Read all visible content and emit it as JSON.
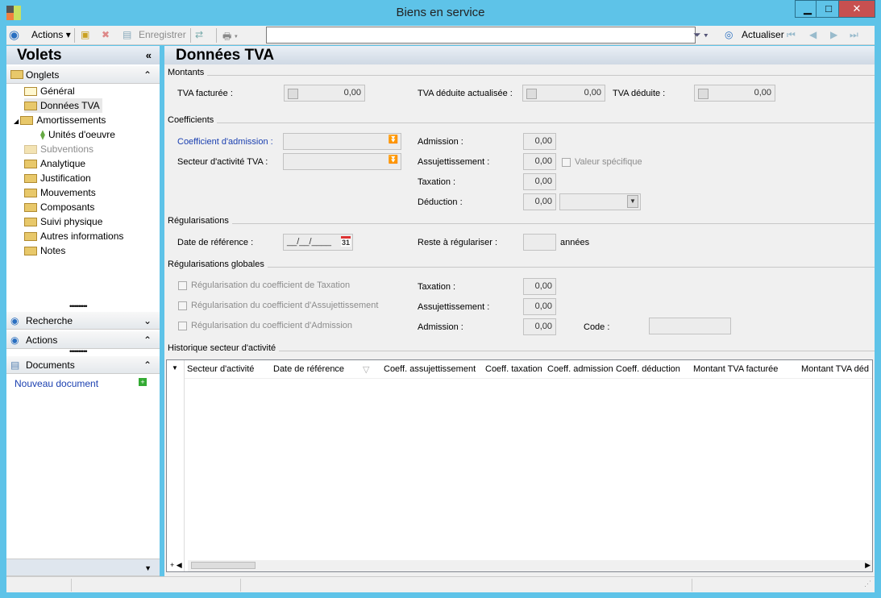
{
  "window": {
    "title": "Biens en service"
  },
  "toolbar": {
    "actions": "Actions",
    "save": "Enregistrer",
    "search_value": "",
    "refresh": "Actualiser"
  },
  "left": {
    "title": "Volets",
    "onglets": "Onglets",
    "tree": [
      "Général",
      "Données TVA",
      "Amortissements",
      "Unités d'oeuvre",
      "Subventions",
      "Analytique",
      "Justification",
      "Mouvements",
      "Composants",
      "Suivi physique",
      "Autres informations",
      "Notes"
    ],
    "recherche": "Recherche",
    "actions": "Actions",
    "documents": "Documents",
    "new_document": "Nouveau document"
  },
  "main": {
    "title": "Données TVA",
    "montants": {
      "label": "Montants",
      "tva_facturee": "TVA facturée :",
      "tva_facturee_val": "0,00",
      "tva_deduite_act": "TVA déduite actualisée :",
      "tva_deduite_act_val": "0,00",
      "tva_deduite": "TVA déduite :",
      "tva_deduite_val": "0,00"
    },
    "coefficients": {
      "label": "Coefficients",
      "coef_admission": "Coefficient d'admission :",
      "secteur": "Secteur d'activité TVA :",
      "admission": "Admission :",
      "admission_val": "0,00",
      "assujettissement": "Assujettissement :",
      "assujettissement_val": "0,00",
      "valeur_specifique": "Valeur spécifique",
      "taxation": "Taxation :",
      "taxation_val": "0,00",
      "deduction": "Déduction :",
      "deduction_val": "0,00"
    },
    "regularisations": {
      "label": "Régularisations",
      "date_ref": "Date de référence :",
      "date_val": "__/__/____",
      "reste": "Reste à régulariser :",
      "annees": "années",
      "cal": "31"
    },
    "reg_globales": {
      "label": "Régularisations globales",
      "chk1": "Régularisation du coefficient de Taxation",
      "chk2": "Régularisation du coefficient d'Assujettissement",
      "chk3": "Régularisation du coefficient d'Admission",
      "taxation": "Taxation :",
      "taxation_val": "0,00",
      "assujettissement": "Assujettissement :",
      "assujettissement_val": "0,00",
      "admission": "Admission :",
      "admission_val": "0,00",
      "code": "Code :"
    },
    "historique": {
      "label": "Historique secteur d'activité",
      "columns": [
        "Secteur d'activité",
        "Date de référence",
        "Coeff. assujettissement",
        "Coeff. taxation",
        "Coeff. admission",
        "Coeff. déduction",
        "Montant TVA facturée",
        "Montant TVA déd"
      ]
    }
  }
}
